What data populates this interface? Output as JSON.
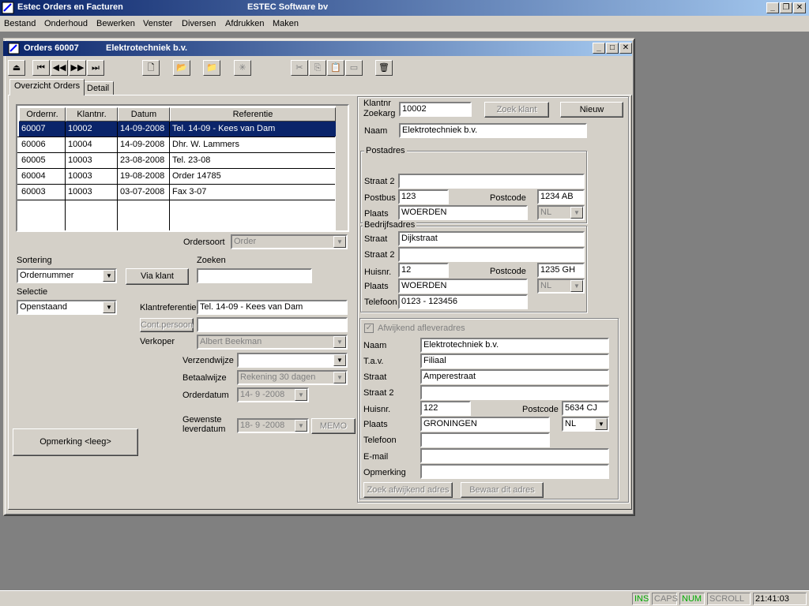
{
  "app": {
    "title": "Estec Orders en Facturen",
    "company": "ESTEC Software bv"
  },
  "menu": [
    "Bestand",
    "Onderhoud",
    "Bewerken",
    "Venster",
    "Diversen",
    "Afdrukken",
    "Maken"
  ],
  "window": {
    "title": "Orders  60007",
    "subtitle": "Elektrotechniek b.v."
  },
  "tabs": [
    "Overzicht Orders",
    "Detail"
  ],
  "grid": {
    "headers": [
      "Ordernr.",
      "Klantnr.",
      "Datum",
      "Referentie"
    ],
    "rows": [
      [
        "60007",
        "10002",
        "14-09-2008",
        "Tel. 14-09 - Kees van Dam"
      ],
      [
        "60006",
        "10004",
        "14-09-2008",
        "Dhr. W. Lammers"
      ],
      [
        "60005",
        "10003",
        "23-08-2008",
        "Tel. 23-08"
      ],
      [
        "60004",
        "10003",
        "19-08-2008",
        "Order 14785"
      ],
      [
        "60003",
        "10003",
        "03-07-2008",
        "Fax 3-07"
      ]
    ]
  },
  "left": {
    "ordersoort_label": "Ordersoort",
    "ordersoort_value": "Order",
    "sortering_label": "Sortering",
    "sortering_value": "Ordernummer",
    "via_klant": "Via klant",
    "zoeken_label": "Zoeken",
    "zoeken_value": "",
    "selectie_label": "Selectie",
    "selectie_value": "Openstaand",
    "klantref_label": "Klantreferentie",
    "klantref_value": "Tel. 14-09 - Kees van Dam",
    "contpersoon_btn": "Cont.persoon",
    "contpersoon_value": "",
    "verkoper_label": "Verkoper",
    "verkoper_value": "Albert Beekman",
    "verzendwijze_label": "Verzendwijze",
    "verzendwijze_value": "",
    "betaalwijze_label": "Betaalwijze",
    "betaalwijze_value": "Rekening 30 dagen",
    "orderdatum_label": "Orderdatum",
    "orderdatum_value": "14- 9 -2008",
    "gewenste_label1": "Gewenste",
    "gewenste_label2": "leverdatum",
    "gewenste_value": "18- 9 -2008",
    "memo": "MEMO",
    "opmerking_btn": "Opmerking <leeg>"
  },
  "customer": {
    "klantnr_label": "Klantnr",
    "zoekarg_label": "Zoekarg",
    "klantnr_value": "10002",
    "zoek_klant": "Zoek klant",
    "nieuw": "Nieuw",
    "naam_label": "Naam",
    "naam_value": "Elektrotechniek b.v."
  },
  "postadres": {
    "title": "Postadres",
    "straat2_label": "Straat 2",
    "straat2_value": "",
    "postbus_label": "Postbus",
    "postbus_value": "123",
    "postcode_label": "Postcode",
    "postcode_value": "1234 AB",
    "plaats_label": "Plaats",
    "plaats_value": "WOERDEN",
    "land_value": "NL"
  },
  "bedrijfsadres": {
    "title": "Bedrijfsadres",
    "straat_label": "Straat",
    "straat_value": "Dijkstraat",
    "straat2_label": "Straat 2",
    "straat2_value": "",
    "huisnr_label": "Huisnr.",
    "huisnr_value": "12",
    "postcode_label": "Postcode",
    "postcode_value": "1235 GH",
    "plaats_label": "Plaats",
    "plaats_value": "WOERDEN",
    "land_value": "NL",
    "telefoon_label": "Telefoon",
    "telefoon_value": "0123 - 123456"
  },
  "afleveradres": {
    "checkbox_label": "Afwijkend afleveradres",
    "naam_label": "Naam",
    "naam_value": "Elektrotechniek b.v.",
    "tav_label": "T.a.v.",
    "tav_value": "Filiaal",
    "straat_label": "Straat",
    "straat_value": "Amperestraat",
    "straat2_label": "Straat 2",
    "straat2_value": "",
    "huisnr_label": "Huisnr.",
    "huisnr_value": "122",
    "postcode_label": "Postcode",
    "postcode_value": "5634 CJ",
    "plaats_label": "Plaats",
    "plaats_value": "GRONINGEN",
    "land_value": "NL",
    "telefoon_label": "Telefoon",
    "telefoon_value": "",
    "email_label": "E-mail",
    "email_value": "",
    "opmerking_label": "Opmerking",
    "opmerking_value": "",
    "zoek_btn": "Zoek afwijkend adres",
    "bewaar_btn": "Bewaar dit adres"
  },
  "status": {
    "ins": "INS",
    "caps": "CAPS",
    "num": "NUM",
    "scroll": "SCROLL",
    "time": "21:41:03"
  },
  "icons": {
    "min": "minimize-icon",
    "max": "restore-icon",
    "close": "close-icon",
    "colors": {
      "titlebar": "#0a246a",
      "titlebar_end": "#a6caf0",
      "selection": "#0a246a",
      "face": "#d4d0c8",
      "ins_on": "#00aa00"
    }
  }
}
